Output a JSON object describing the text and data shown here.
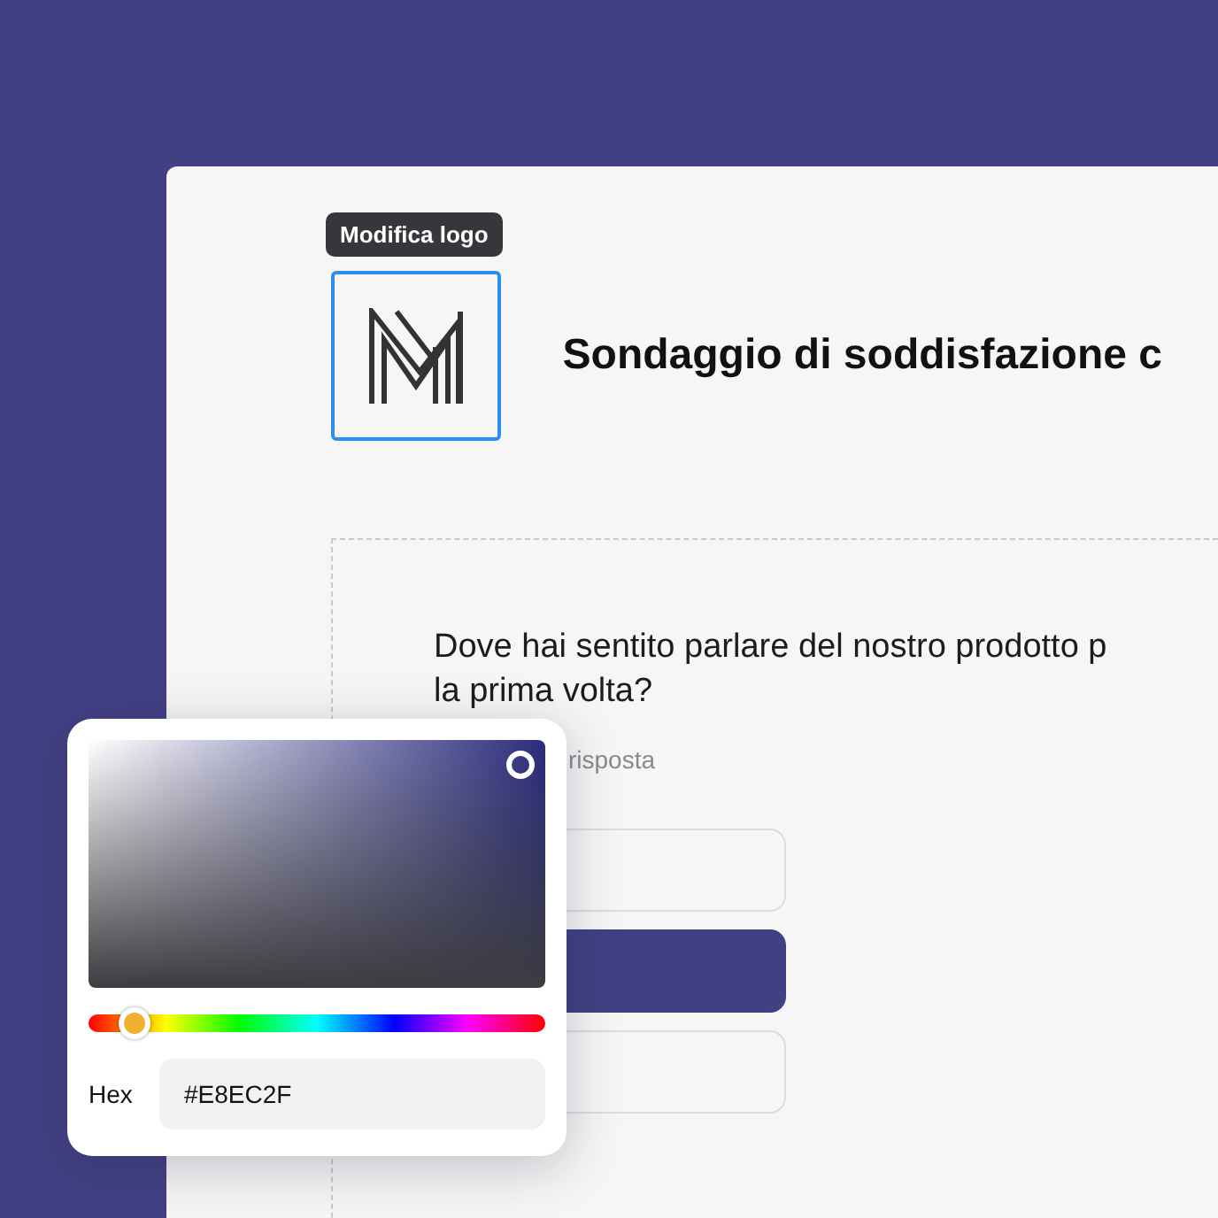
{
  "logo_tooltip": "Modifica logo",
  "survey_title": "Sondaggio di soddisfazione c",
  "question": {
    "lines": [
      "Dove hai sentito parlare del nostro prodotto p",
      "la prima volta?"
    ],
    "hint": "risposta",
    "options": [
      {
        "selected": false
      },
      {
        "selected": true
      },
      {
        "selected": false
      }
    ]
  },
  "color_picker": {
    "hue": {
      "level": 0.1
    },
    "hex_label": "Hex",
    "hex_value": "#E8EC2F"
  }
}
